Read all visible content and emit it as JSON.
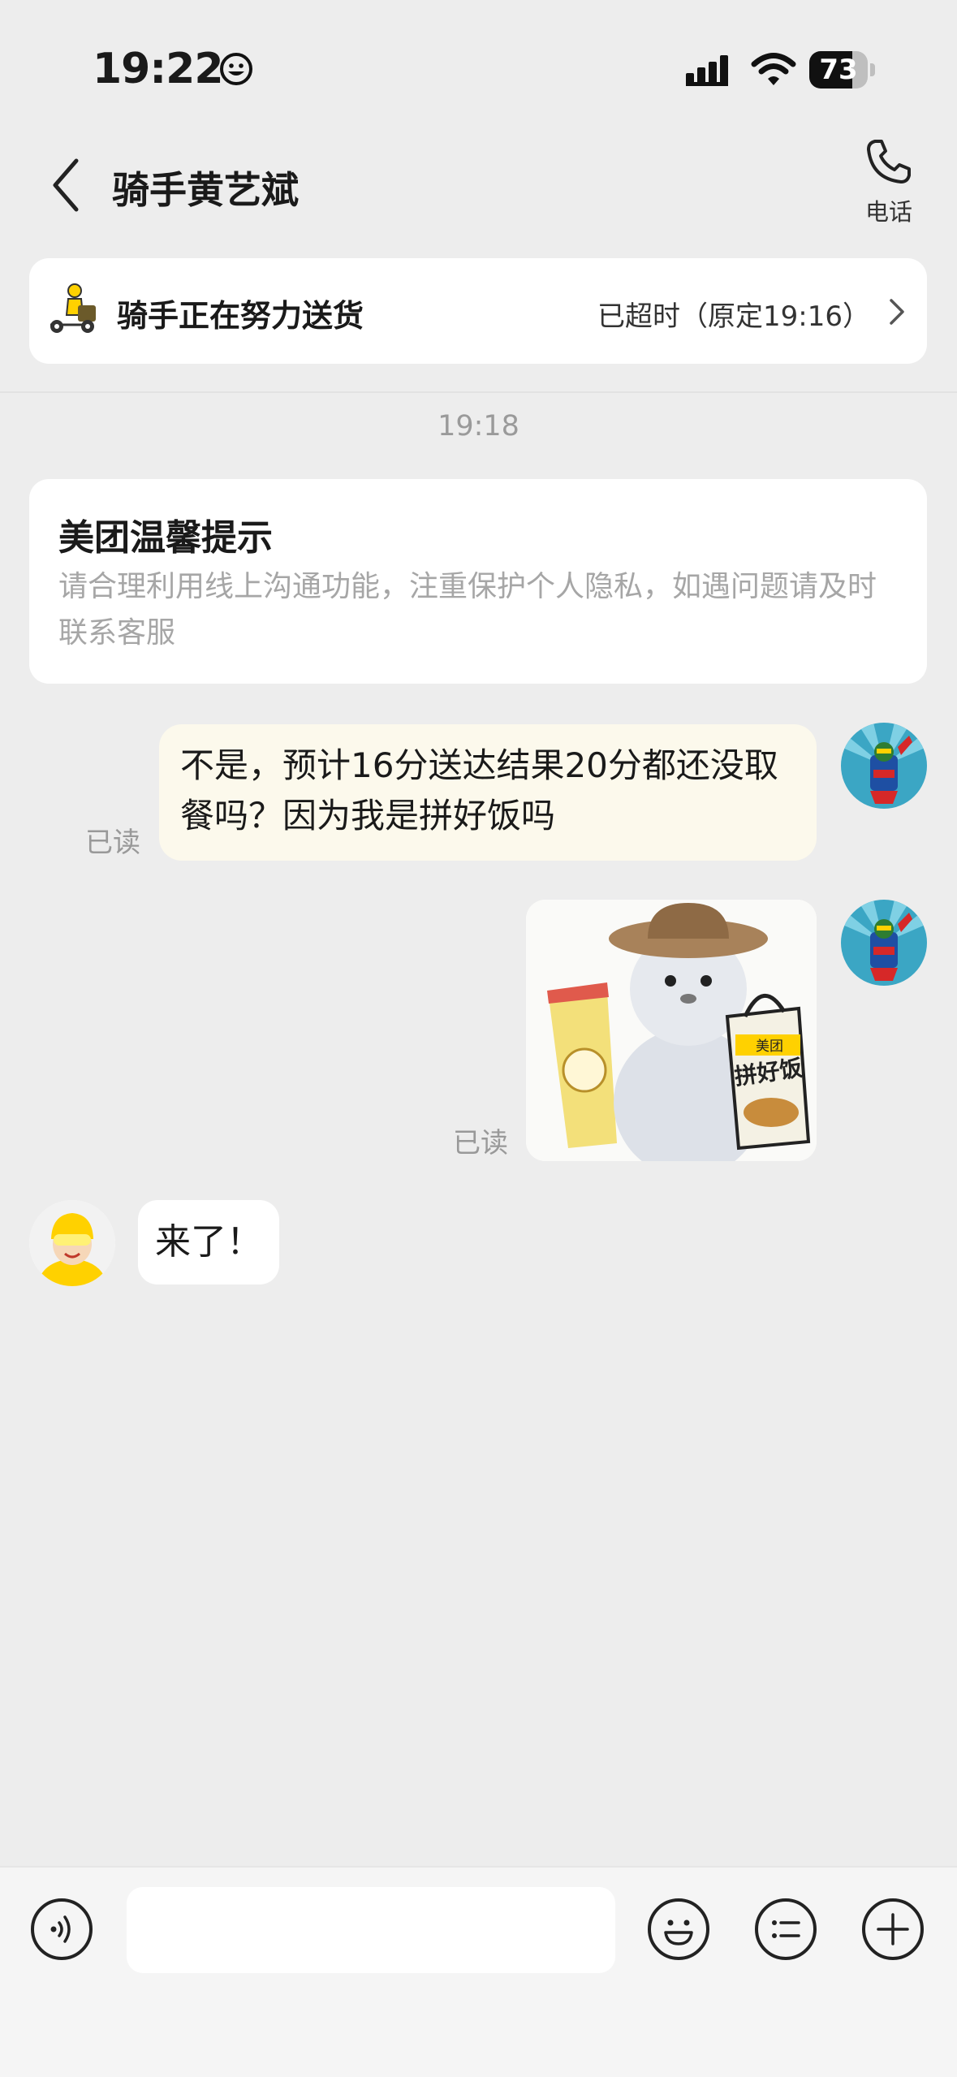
{
  "status_bar": {
    "time": "19:22",
    "battery": "73",
    "battery_level": 0.73
  },
  "header": {
    "title": "骑手黄艺斌",
    "phone_label": "电话"
  },
  "rider_card": {
    "status": "骑手正在努力送货",
    "eta": "已超时（原定19:16）"
  },
  "chat": {
    "timestamp": "19:18",
    "tip": {
      "title": "美团温馨提示",
      "body": "请合理利用线上沟通功能，注重保护个人隐私，如遇问题请及时联系客服"
    },
    "messages": [
      {
        "from": "me",
        "type": "text",
        "text": "不是，预计16分送达结果20分都还没取餐吗？因为我是拼好饭吗",
        "read": "已读"
      },
      {
        "from": "me",
        "type": "sticker",
        "sticker_text": "拼好饭",
        "sticker_brand": "美团",
        "read": "已读"
      },
      {
        "from": "rider",
        "type": "text",
        "text": "来了！"
      }
    ]
  },
  "input": {
    "placeholder": ""
  },
  "icons": {
    "back": "chevron-left-icon",
    "phone": "phone-icon",
    "voice": "voice-icon",
    "emoji": "emoji-icon",
    "quick_reply": "list-icon",
    "more": "plus-icon"
  },
  "colors": {
    "accent": "#FFD100",
    "bubble_me": "#FCF9EC",
    "background": "#EDEDED"
  }
}
